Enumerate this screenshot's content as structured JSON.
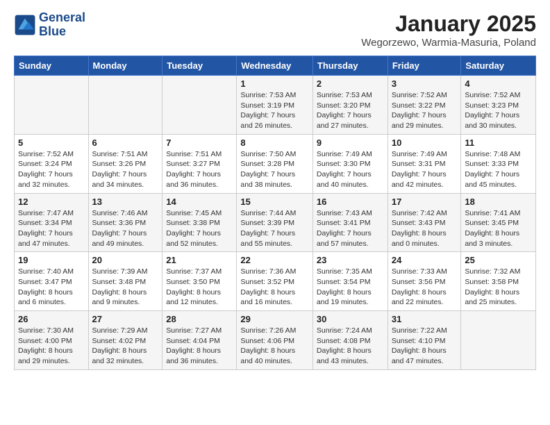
{
  "header": {
    "logo_line1": "General",
    "logo_line2": "Blue",
    "month_year": "January 2025",
    "location": "Wegorzewo, Warmia-Masuria, Poland"
  },
  "days_of_week": [
    "Sunday",
    "Monday",
    "Tuesday",
    "Wednesday",
    "Thursday",
    "Friday",
    "Saturday"
  ],
  "weeks": [
    [
      {
        "day": "",
        "content": ""
      },
      {
        "day": "",
        "content": ""
      },
      {
        "day": "",
        "content": ""
      },
      {
        "day": "1",
        "content": "Sunrise: 7:53 AM\nSunset: 3:19 PM\nDaylight: 7 hours and 26 minutes."
      },
      {
        "day": "2",
        "content": "Sunrise: 7:53 AM\nSunset: 3:20 PM\nDaylight: 7 hours and 27 minutes."
      },
      {
        "day": "3",
        "content": "Sunrise: 7:52 AM\nSunset: 3:22 PM\nDaylight: 7 hours and 29 minutes."
      },
      {
        "day": "4",
        "content": "Sunrise: 7:52 AM\nSunset: 3:23 PM\nDaylight: 7 hours and 30 minutes."
      }
    ],
    [
      {
        "day": "5",
        "content": "Sunrise: 7:52 AM\nSunset: 3:24 PM\nDaylight: 7 hours and 32 minutes."
      },
      {
        "day": "6",
        "content": "Sunrise: 7:51 AM\nSunset: 3:26 PM\nDaylight: 7 hours and 34 minutes."
      },
      {
        "day": "7",
        "content": "Sunrise: 7:51 AM\nSunset: 3:27 PM\nDaylight: 7 hours and 36 minutes."
      },
      {
        "day": "8",
        "content": "Sunrise: 7:50 AM\nSunset: 3:28 PM\nDaylight: 7 hours and 38 minutes."
      },
      {
        "day": "9",
        "content": "Sunrise: 7:49 AM\nSunset: 3:30 PM\nDaylight: 7 hours and 40 minutes."
      },
      {
        "day": "10",
        "content": "Sunrise: 7:49 AM\nSunset: 3:31 PM\nDaylight: 7 hours and 42 minutes."
      },
      {
        "day": "11",
        "content": "Sunrise: 7:48 AM\nSunset: 3:33 PM\nDaylight: 7 hours and 45 minutes."
      }
    ],
    [
      {
        "day": "12",
        "content": "Sunrise: 7:47 AM\nSunset: 3:34 PM\nDaylight: 7 hours and 47 minutes."
      },
      {
        "day": "13",
        "content": "Sunrise: 7:46 AM\nSunset: 3:36 PM\nDaylight: 7 hours and 49 minutes."
      },
      {
        "day": "14",
        "content": "Sunrise: 7:45 AM\nSunset: 3:38 PM\nDaylight: 7 hours and 52 minutes."
      },
      {
        "day": "15",
        "content": "Sunrise: 7:44 AM\nSunset: 3:39 PM\nDaylight: 7 hours and 55 minutes."
      },
      {
        "day": "16",
        "content": "Sunrise: 7:43 AM\nSunset: 3:41 PM\nDaylight: 7 hours and 57 minutes."
      },
      {
        "day": "17",
        "content": "Sunrise: 7:42 AM\nSunset: 3:43 PM\nDaylight: 8 hours and 0 minutes."
      },
      {
        "day": "18",
        "content": "Sunrise: 7:41 AM\nSunset: 3:45 PM\nDaylight: 8 hours and 3 minutes."
      }
    ],
    [
      {
        "day": "19",
        "content": "Sunrise: 7:40 AM\nSunset: 3:47 PM\nDaylight: 8 hours and 6 minutes."
      },
      {
        "day": "20",
        "content": "Sunrise: 7:39 AM\nSunset: 3:48 PM\nDaylight: 8 hours and 9 minutes."
      },
      {
        "day": "21",
        "content": "Sunrise: 7:37 AM\nSunset: 3:50 PM\nDaylight: 8 hours and 12 minutes."
      },
      {
        "day": "22",
        "content": "Sunrise: 7:36 AM\nSunset: 3:52 PM\nDaylight: 8 hours and 16 minutes."
      },
      {
        "day": "23",
        "content": "Sunrise: 7:35 AM\nSunset: 3:54 PM\nDaylight: 8 hours and 19 minutes."
      },
      {
        "day": "24",
        "content": "Sunrise: 7:33 AM\nSunset: 3:56 PM\nDaylight: 8 hours and 22 minutes."
      },
      {
        "day": "25",
        "content": "Sunrise: 7:32 AM\nSunset: 3:58 PM\nDaylight: 8 hours and 25 minutes."
      }
    ],
    [
      {
        "day": "26",
        "content": "Sunrise: 7:30 AM\nSunset: 4:00 PM\nDaylight: 8 hours and 29 minutes."
      },
      {
        "day": "27",
        "content": "Sunrise: 7:29 AM\nSunset: 4:02 PM\nDaylight: 8 hours and 32 minutes."
      },
      {
        "day": "28",
        "content": "Sunrise: 7:27 AM\nSunset: 4:04 PM\nDaylight: 8 hours and 36 minutes."
      },
      {
        "day": "29",
        "content": "Sunrise: 7:26 AM\nSunset: 4:06 PM\nDaylight: 8 hours and 40 minutes."
      },
      {
        "day": "30",
        "content": "Sunrise: 7:24 AM\nSunset: 4:08 PM\nDaylight: 8 hours and 43 minutes."
      },
      {
        "day": "31",
        "content": "Sunrise: 7:22 AM\nSunset: 4:10 PM\nDaylight: 8 hours and 47 minutes."
      },
      {
        "day": "",
        "content": ""
      }
    ]
  ]
}
